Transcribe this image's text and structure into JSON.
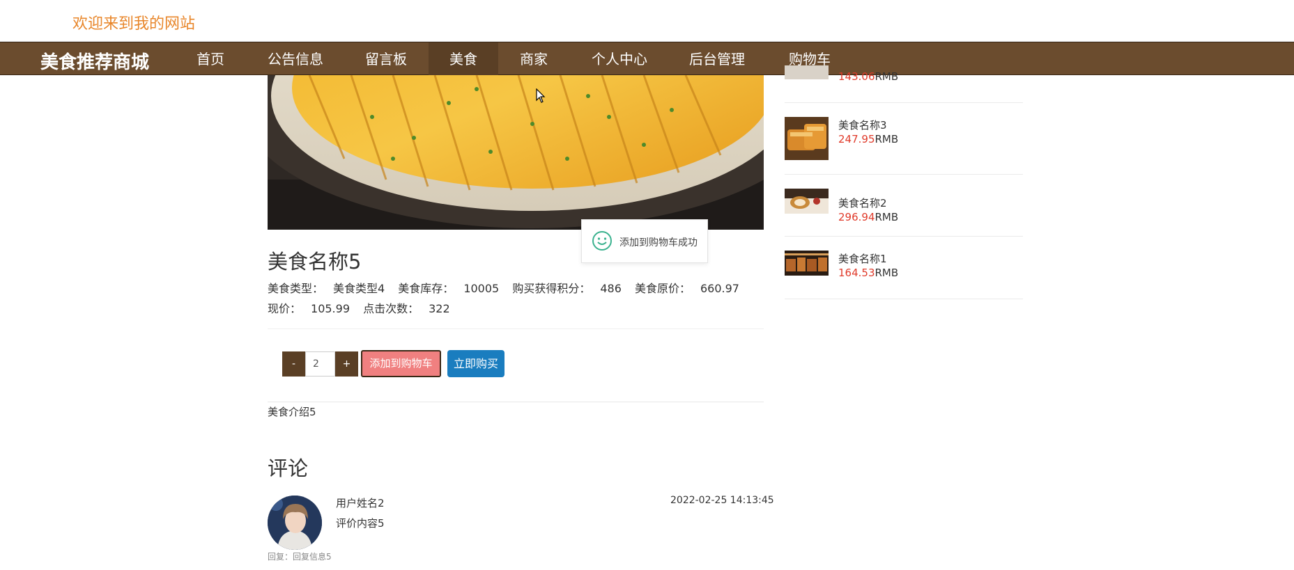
{
  "header": {
    "welcome": "欢迎来到我的网站"
  },
  "nav": {
    "brand": "美食推荐商城",
    "items": [
      {
        "label": "首页"
      },
      {
        "label": "公告信息"
      },
      {
        "label": "留言板"
      },
      {
        "label": "美食",
        "active": true
      },
      {
        "label": "商家"
      },
      {
        "label": "个人中心"
      },
      {
        "label": "后台管理"
      },
      {
        "label": "购物车"
      }
    ]
  },
  "toast": {
    "message": "添加到购物车成功"
  },
  "product": {
    "name": "美食名称5",
    "type_label": "美食类型：",
    "type_value": "美食类型4",
    "stock_label": "美食库存：",
    "stock_value": "10005",
    "points_label": "购买获得积分：",
    "points_value": "486",
    "orig_price_label": "美食原价：",
    "orig_price_value": "660.97",
    "price_label": "现价：",
    "price_value": "105.99",
    "clicks_label": "点击次数：",
    "clicks_value": "322",
    "intro": "美食介绍5"
  },
  "cart": {
    "minus": "-",
    "plus": "+",
    "quantity": "2",
    "add_label": "添加到购物车",
    "buy_label": "立即购买"
  },
  "comments": {
    "title": "评论",
    "items": [
      {
        "user": "用户姓名2",
        "time": "2022-02-25 14:13:45",
        "content": "评价内容5",
        "reply": "回复：回复信息5"
      }
    ]
  },
  "sidebar": {
    "items": [
      {
        "name": "",
        "price": "143.06",
        "unit": "RMB"
      },
      {
        "name": "美食名称3",
        "price": "247.95",
        "unit": "RMB"
      },
      {
        "name": "美食名称2",
        "price": "296.94",
        "unit": "RMB"
      },
      {
        "name": "美食名称1",
        "price": "164.53",
        "unit": "RMB"
      }
    ]
  },
  "colors": {
    "nav_bg": "#6b4c2e",
    "welcome": "#e8862a",
    "price_red": "#e03a2a",
    "add_cart_bg": "#f08080",
    "buy_bg": "#1a7dbf"
  }
}
